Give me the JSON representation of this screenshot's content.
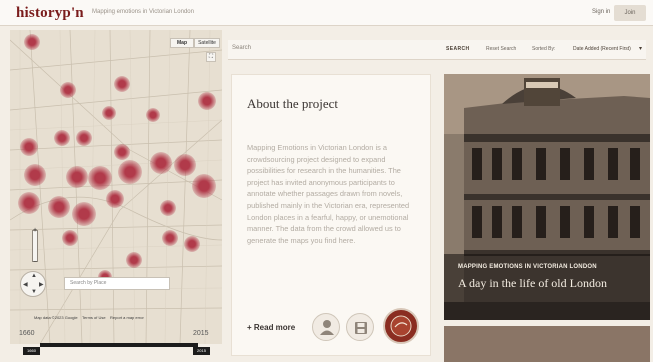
{
  "header": {
    "logo": "historyp'n",
    "tagline": "Mapping emotions in Victorian London",
    "signin_label": "Sign in",
    "join_label": "Join"
  },
  "map": {
    "type_map": "Map",
    "type_satellite": "Satellite",
    "search_placeholder": "Search by Place",
    "scale_text": "Map data ©2023 Google",
    "terms": "Terms of Use",
    "report": "Report a map error",
    "hotspot_color": "#b13a4a",
    "street_color": "#c9bfae"
  },
  "timeline": {
    "start_year": "1660",
    "end_year": "2015",
    "handle_start": "1660",
    "handle_end": "2015"
  },
  "searchbar": {
    "placeholder": "Search",
    "search_label": "SEARCH",
    "reset_label": "Reset Search",
    "sort_label": "Sorted By:",
    "sort_value": "Date Added (Recent First)"
  },
  "about": {
    "title": "About the project",
    "body": "Mapping Emotions in Victorian London is a crowdsourcing project designed to expand possibilities for research in the humanities. The project has invited anonymous participants to annotate whether passages drawn from novels, published mainly in the Victorian era, represented London places in a fearful, happy, or unemotional manner. The data from the crowd allowed us to generate the maps you find here.",
    "read_more": "+ Read more"
  },
  "photo": {
    "subtitle": "MAPPING EMOTIONS IN VICTORIAN LONDON",
    "title": "A day in the life of old London"
  },
  "colors": {
    "brand": "#7a1c1c",
    "accent_badge": "#8a2d21"
  }
}
